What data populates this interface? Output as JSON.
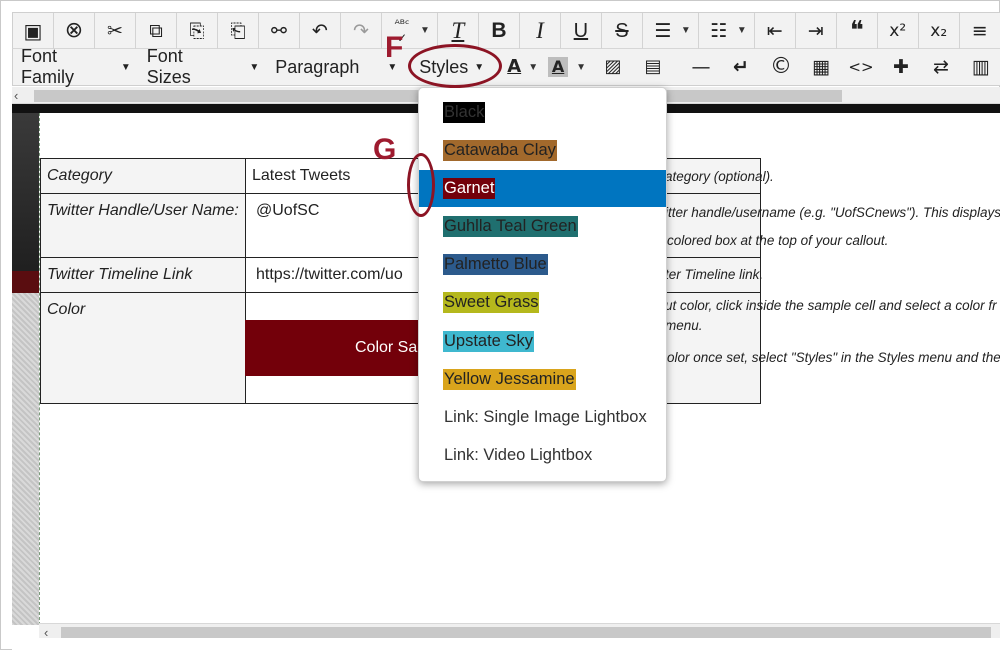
{
  "toolbar_row1": [
    {
      "icon": "save-icon",
      "glyph": "💾"
    },
    {
      "icon": "cancel-icon",
      "glyph": "⊗"
    },
    {
      "icon": "cut-icon",
      "glyph": "✂"
    },
    {
      "icon": "copy-icon",
      "glyph": "⧉"
    },
    {
      "icon": "paste-icon",
      "glyph": "📋"
    },
    {
      "icon": "paste-text-icon",
      "glyph": "📋"
    },
    {
      "icon": "find-icon",
      "glyph": "⚲"
    },
    {
      "icon": "undo-icon",
      "glyph": "↶"
    },
    {
      "icon": "redo-icon",
      "glyph": "↷"
    },
    {
      "icon": "spellcheck-icon",
      "glyph": "✓"
    },
    {
      "icon": "clear-format-icon",
      "glyph": "T"
    },
    {
      "icon": "bold-icon",
      "glyph": "B"
    },
    {
      "icon": "italic-icon",
      "glyph": "I"
    },
    {
      "icon": "underline-icon",
      "glyph": "U"
    },
    {
      "icon": "strikethrough-icon",
      "glyph": "S"
    },
    {
      "icon": "bullet-list-icon",
      "glyph": "☰"
    },
    {
      "icon": "numbered-list-icon",
      "glyph": "☷"
    },
    {
      "icon": "outdent-icon",
      "glyph": "⇤"
    },
    {
      "icon": "indent-icon",
      "glyph": "⇥"
    },
    {
      "icon": "blockquote-icon",
      "glyph": "❝"
    },
    {
      "icon": "superscript-icon",
      "glyph": "x²"
    },
    {
      "icon": "subscript-icon",
      "glyph": "x₂"
    },
    {
      "icon": "align-left-icon",
      "glyph": "≡"
    }
  ],
  "toolbar_row2": {
    "font_family": "Font Family",
    "font_sizes": "Font Sizes",
    "paragraph": "Paragraph",
    "styles": "Styles",
    "text_color_glyph": "A",
    "bg_color_glyph": "A",
    "icons": [
      {
        "icon": "image-icon",
        "glyph": "🖼"
      },
      {
        "icon": "media-icon",
        "glyph": "🎞"
      },
      {
        "icon": "horizontal-rule-icon",
        "glyph": "—"
      },
      {
        "icon": "line-break-icon",
        "glyph": "↵"
      },
      {
        "icon": "copyright-icon",
        "glyph": "©"
      },
      {
        "icon": "table-icon",
        "glyph": "▦"
      },
      {
        "icon": "code-icon",
        "glyph": "<>"
      },
      {
        "icon": "plugin-icon",
        "glyph": "✦"
      },
      {
        "icon": "replace-icon",
        "glyph": "⇄"
      }
    ]
  },
  "table": {
    "rows": [
      {
        "label": "Category",
        "value": "Latest Tweets",
        "help": "ategory (optional)."
      },
      {
        "label": "Twitter Handle/User Name:",
        "value": "@UofSC",
        "help": "itter handle/username (e.g. \"UofSCnews\"). This displays",
        "help2": "colored box at the top of your callout."
      },
      {
        "label": "Twitter Timeline Link",
        "value": "https://twitter.com/uo",
        "help": "ter Timeline link."
      },
      {
        "label": "Color",
        "value": "",
        "help": "ut color, click inside the sample cell and select a color fr",
        "help2": "menu.",
        "help3": "olor once set, select \"Styles\" in the Styles menu and ther"
      }
    ],
    "swatch_text": "Color Sa"
  },
  "styles_menu": {
    "items": [
      {
        "label": "Black",
        "bg": "#000000",
        "fg": "#333333"
      },
      {
        "label": "Catawaba Clay",
        "bg": "#a2692c",
        "fg": "#222222"
      },
      {
        "label": "Garnet",
        "bg": "#73000a",
        "fg": "#ffffff",
        "selected": true
      },
      {
        "label": "Guhlla Teal Green",
        "bg": "#1f6f6f",
        "fg": "#222222"
      },
      {
        "label": "Palmetto Blue",
        "bg": "#2c5a8c",
        "fg": "#222222"
      },
      {
        "label": "Sweet Grass",
        "bg": "#b5b81c",
        "fg": "#222222"
      },
      {
        "label": "Upstate Sky",
        "bg": "#3fb8cf",
        "fg": "#222222"
      },
      {
        "label": "Yellow Jessamine",
        "bg": "#d9a41c",
        "fg": "#222222"
      },
      {
        "label": "Link: Single Image Lightbox",
        "bg": "",
        "fg": "#333333"
      },
      {
        "label": "Link: Video Lightbox",
        "bg": "",
        "fg": "#333333"
      }
    ]
  },
  "annotations": {
    "f": "F",
    "g": "G"
  },
  "colors": {
    "accent_selected": "#0075c0",
    "annotation": "#9e1b2f",
    "garnet": "#73000a"
  }
}
